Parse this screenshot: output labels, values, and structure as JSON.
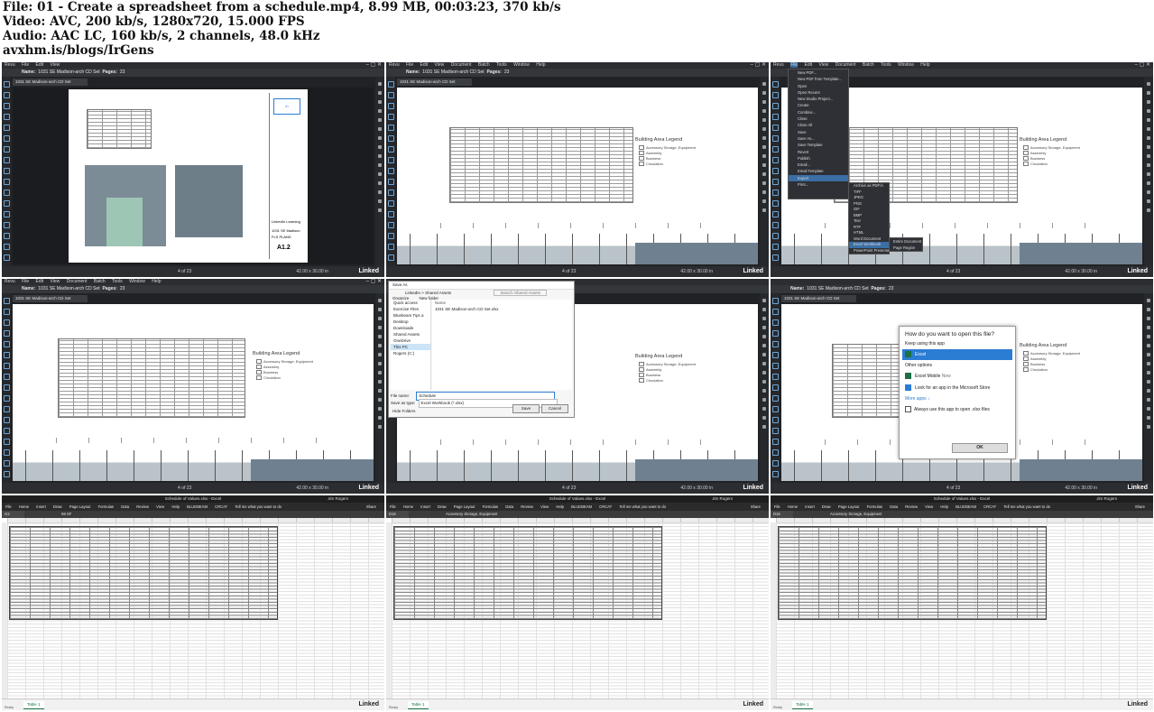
{
  "header": {
    "line1": "File: 01 - Create a spreadsheet from a schedule.mp4, 8.99 MB, 00:03:23, 370 kb/s",
    "line2": "Video: AVC, 200 kb/s, 1280x720, 15.000 FPS",
    "line3": "Audio: AAC LC, 160 kb/s, 2 channels, 48.0 kHz",
    "line4": "avxhm.is/blogs/IrGens"
  },
  "revu": {
    "menu": [
      "Revu",
      "File",
      "Edit",
      "View",
      "Document",
      "Batch",
      "Tools",
      "Window",
      "Help"
    ],
    "name_label": "Name:",
    "name_value": "1031 SE Madison-arch CD Set",
    "pages_label": "Pages:",
    "pages_value": "23",
    "doc_tab": "1031 SE Madison-arch CD Set",
    "page_indicator": "4 of 23",
    "dimensions": "42.00 x 30.00 in",
    "brand": "Linked"
  },
  "drawing": {
    "legend_title": "Building Area Legend",
    "legend_items": [
      "Accessory Storage, Equipment",
      "Assembly",
      "Business",
      "Circulation"
    ],
    "sheet_company": "LinkedIn Learning",
    "sheet_number": "A1.2",
    "sheet_name": "1031 SE Madison",
    "sheet_sub": "FLS PLANS"
  },
  "file_menu": {
    "items": [
      "New PDF...",
      "New PDF from Template...",
      "Open",
      "Open Recent",
      "New Studio Project...",
      "Create",
      "Combine...",
      "Close",
      "Close All",
      "Save",
      "Save As...",
      "Save Template",
      "Revert",
      "Publish",
      "Email...",
      "Email Template",
      "Export",
      "Print..."
    ],
    "export_sub": [
      "Archive as PDF/A",
      "TIFF",
      "JPEG",
      "PNG",
      "GIF",
      "BMP",
      "Text",
      "RTF",
      "HTML",
      "Word Document",
      "Excel Workbook",
      "PowerPoint Presentation"
    ],
    "excel_sub": [
      "Entire Document",
      "Page Region"
    ]
  },
  "save_dialog": {
    "title": "Save As",
    "path": "LinkedIn > Shared Assets",
    "search": "Search Shared Assets",
    "organize": "Organize",
    "new_folder": "New folder",
    "nav": [
      "Quick access",
      "Exercise Files",
      "Bluebeam Tips a",
      "Desktop",
      "Downloads",
      "Shared Assets",
      "OneDrive",
      "This PC",
      "Rogers (C:)"
    ],
    "file_row": "1031 SE Madison-arch CD Set.xlsx",
    "col_name": "Name",
    "file_name_label": "File name:",
    "file_name_value": "Schedule",
    "save_type_label": "Save as type:",
    "save_type_value": "Excel Workbook (*.xlsx)",
    "hide_folders": "Hide Folders",
    "save_btn": "Save",
    "cancel_btn": "Cancel"
  },
  "open_with": {
    "question": "How do you want to open this file?",
    "keep": "Keep using this app",
    "selected": "Excel",
    "other": "Other options",
    "opt1": "Excel Mobile",
    "opt1_sub": "New",
    "opt2": "Look for an app in the Microsoft Store",
    "more": "More apps",
    "always": "Always use this app to open .xlsx files",
    "ok": "OK"
  },
  "excel": {
    "title": "Schedule of Values.xlsx - Excel",
    "user": "Jim Rogers",
    "ribbon": [
      "File",
      "Home",
      "Insert",
      "Draw",
      "Page Layout",
      "Formulas",
      "Data",
      "Review",
      "View",
      "Help",
      "BLUEBEAM",
      "CRCAT",
      "Tell me what you want to do"
    ],
    "share": "Share",
    "cell_ref": "G3",
    "cell_ref_b": "D16",
    "formula_a": "68 SF",
    "formula_b": "Accessory Storage, Equipment",
    "sheet_tab": "Table 1",
    "ready": "Ready",
    "brand": "Linked"
  }
}
